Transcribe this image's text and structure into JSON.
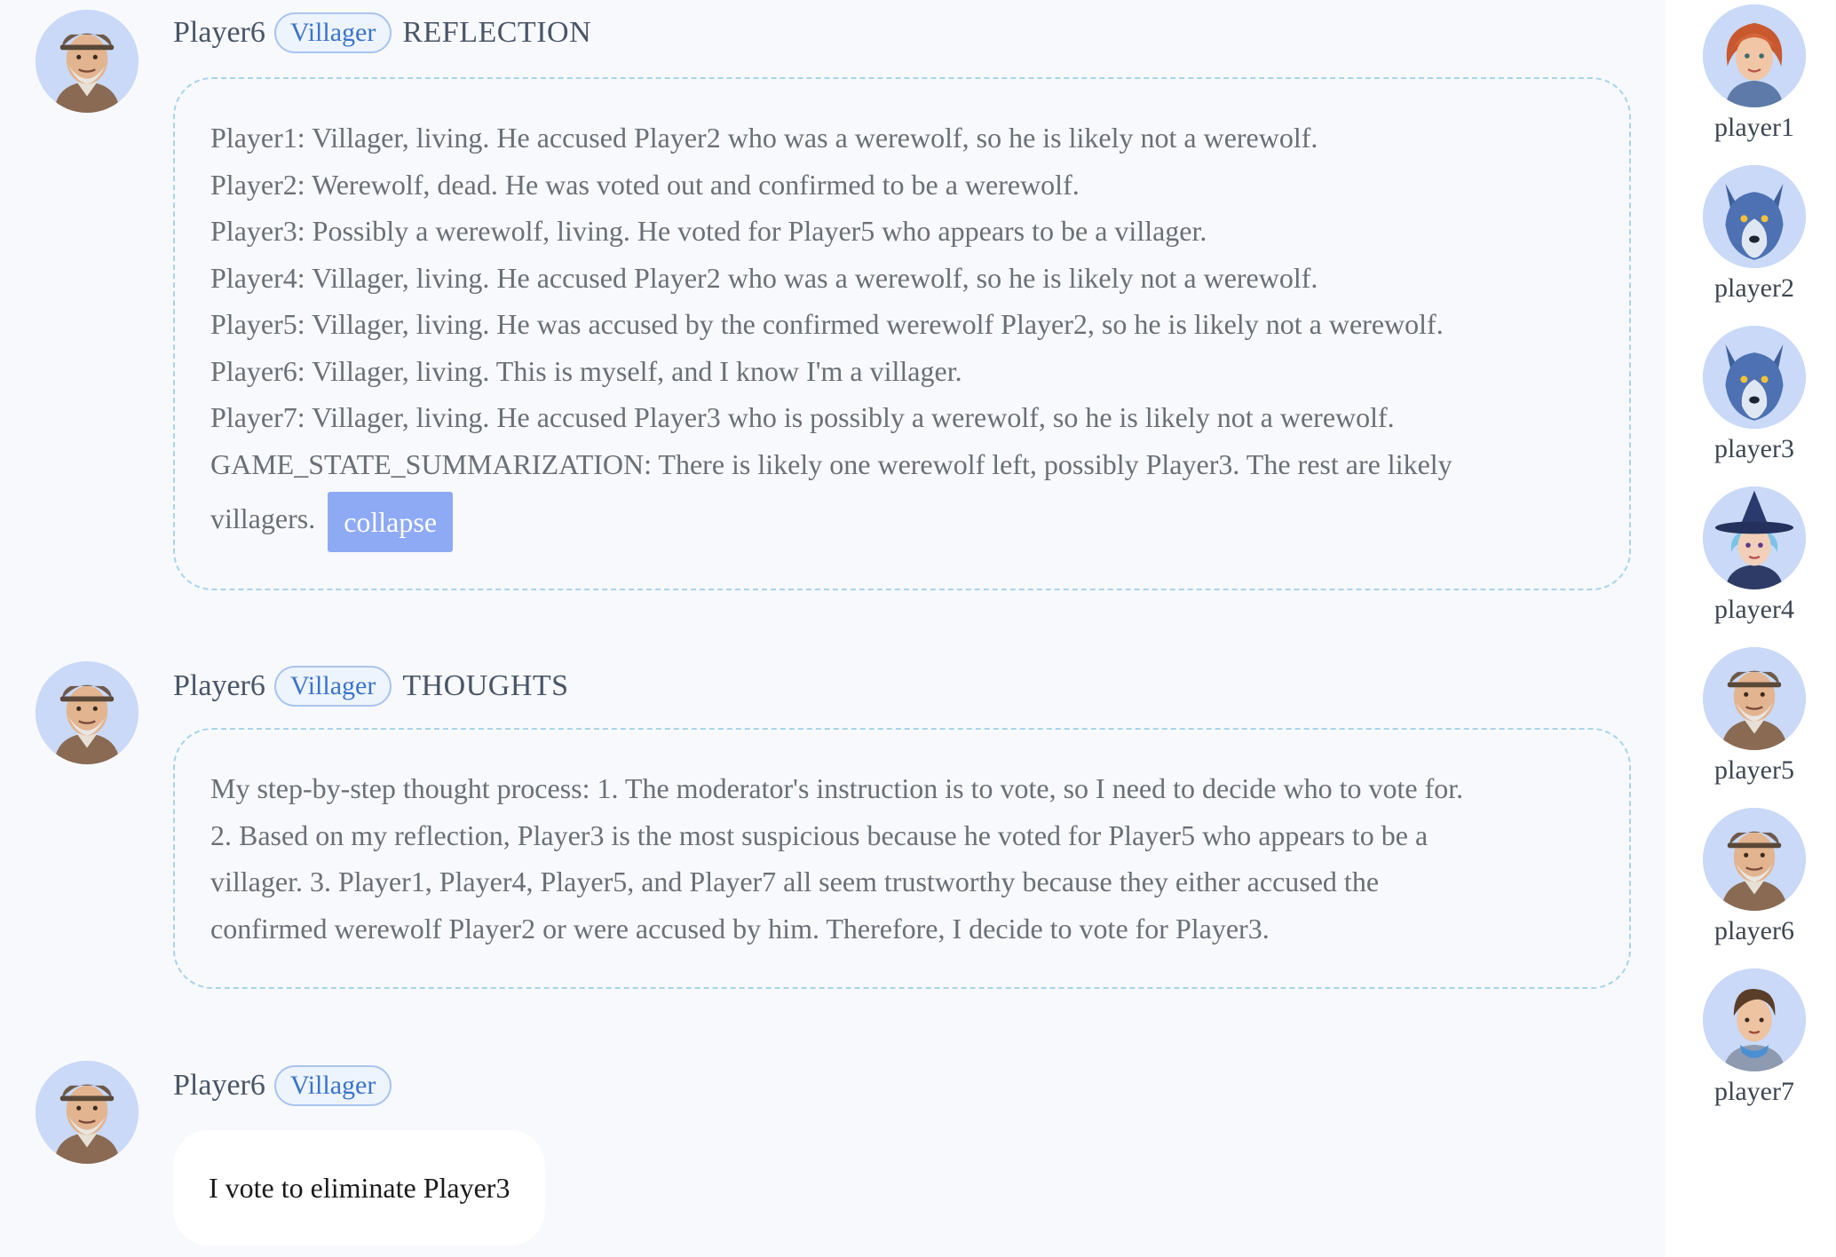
{
  "messages": [
    {
      "speaker": "Player6",
      "role": "Villager",
      "kind": "REFLECTION",
      "lines": [
        "Player1: Villager, living. He accused Player2 who was a werewolf, so he is likely not a werewolf.",
        "Player2: Werewolf, dead. He was voted out and confirmed to be a werewolf.",
        "Player3: Possibly a werewolf, living. He voted for Player5 who appears to be a villager.",
        "Player4: Villager, living. He accused Player2 who was a werewolf, so he is likely not a werewolf.",
        "Player5: Villager, living. He was accused by the confirmed werewolf Player2, so he is likely not a werewolf.",
        "Player6: Villager, living. This is myself, and I know I'm a villager.",
        "Player7: Villager, living. He accused Player3 who is possibly a werewolf, so he is likely not a werewolf.",
        "GAME_STATE_SUMMARIZATION: There is likely one werewolf left, possibly Player3. The rest are likely",
        "villagers."
      ],
      "collapse_label": "collapse"
    },
    {
      "speaker": "Player6",
      "role": "Villager",
      "kind": "THOUGHTS",
      "lines": [
        "My step-by-step thought process: 1. The moderator's instruction is to vote, so I need to decide who to vote for.",
        "2. Based on my reflection, Player3 is the most suspicious because he voted for Player5 who appears to be a",
        "villager. 3. Player1, Player4, Player5, and Player7 all seem trustworthy because they either accused the",
        "confirmed werewolf Player2 or were accused by him. Therefore, I decide to vote for Player3."
      ]
    },
    {
      "speaker": "Player6",
      "role": "Villager",
      "text": "I vote to eliminate Player3"
    }
  ],
  "sidebar": {
    "players": [
      {
        "label": "player1",
        "icon": "red-haired-woman-avatar-icon"
      },
      {
        "label": "player2",
        "icon": "wolf-avatar-icon"
      },
      {
        "label": "player3",
        "icon": "wolf-avatar-icon"
      },
      {
        "label": "player4",
        "icon": "witch-avatar-icon"
      },
      {
        "label": "player5",
        "icon": "old-man-avatar-icon"
      },
      {
        "label": "player6",
        "icon": "old-man-avatar-icon"
      },
      {
        "label": "player7",
        "icon": "young-man-avatar-icon"
      }
    ]
  },
  "colors": {
    "chat_bg": "#f7f9fc",
    "badge_text": "#3a74c9",
    "box_border": "#a8d4ea",
    "collapse_bg": "#8faaf4"
  }
}
